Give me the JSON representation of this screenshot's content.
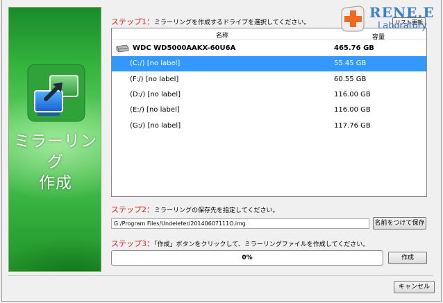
{
  "sidebar": {
    "title_line1": "ミラーリング",
    "title_line2": "作成"
  },
  "step1": {
    "label": "ステップ1：",
    "text": "ミラーリングを作成するドライブを選択してください。",
    "refresh_label": "リスト更新"
  },
  "drive_list": {
    "col_name": "名称",
    "col_capacity": "容量",
    "disk": {
      "name": "WDC WD5000AAKX-60U6A",
      "capacity": "465.76 GB",
      "icon": "hard-disk-icon"
    },
    "partitions": [
      {
        "name": "(C:/) [no label]",
        "capacity": "55.45 GB",
        "selected": true
      },
      {
        "name": "(F:/) [no label]",
        "capacity": "60.55 GB",
        "selected": false
      },
      {
        "name": "(D:/) [no label]",
        "capacity": "116.00 GB",
        "selected": false
      },
      {
        "name": "(E:/) [no label]",
        "capacity": "116.00 GB",
        "selected": false
      },
      {
        "name": "(G:/) [no label]",
        "capacity": "117.76 GB",
        "selected": false
      }
    ]
  },
  "step2": {
    "label": "ステップ2：",
    "text": "ミラーリングの保存先を指定してください。",
    "path_value": "G:/Program Files/Undeleter/20140607111O.img",
    "save_as_label": "名前をつけて保存"
  },
  "step3": {
    "label": "ステップ3：",
    "text": "「作成」ボタンをクリックして、ミラーリングファイルを作成してください。",
    "progress_text": "0%",
    "progress_value": 0,
    "create_label": "作成"
  },
  "footer": {
    "cancel_label": "キャンセル"
  },
  "logo": {
    "line1": "RENE.E",
    "line2": "Laboratory"
  },
  "colors": {
    "accent_red": "#e02020",
    "selection_blue": "#3399ff",
    "panel_green": "#34b43e",
    "logo_blue": "#3f7fcf"
  }
}
